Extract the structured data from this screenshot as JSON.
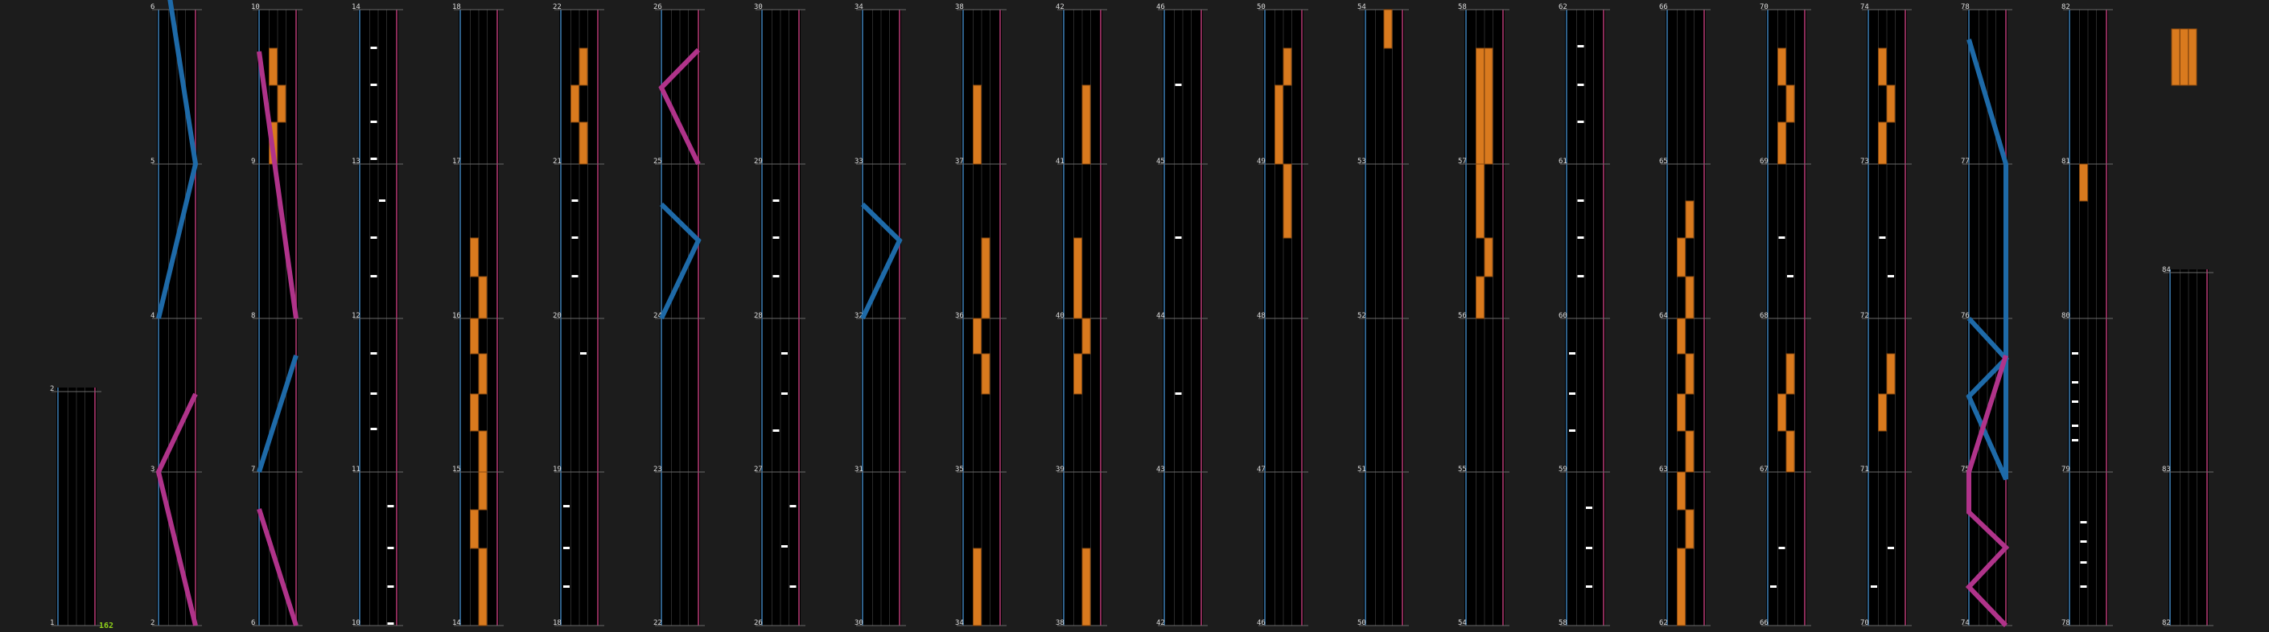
{
  "theme": {
    "background": "#1c1c1c",
    "lane_bg": "#000000",
    "grid": "#2a2a2a",
    "measure_line": "#6a6a6a",
    "left_border": "#2e5f88",
    "right_border": "#8a2c58",
    "note_color": "#ffffff",
    "hold_color": "#d97a1e",
    "hold_border": "#8a4a10",
    "laser_left": "#1e6aa8",
    "laser_right": "#b0338a",
    "combo_color": "#8fd11a",
    "label_color": "#dddddd"
  },
  "combo": "162",
  "columns": [
    {
      "labels": [
        "1",
        "2"
      ],
      "partial": true
    },
    {
      "labels": [
        "2",
        "3",
        "4",
        "5",
        "6"
      ]
    },
    {
      "labels": [
        "6",
        "7",
        "8",
        "9",
        "10"
      ]
    },
    {
      "labels": [
        "10",
        "11",
        "12",
        "13",
        "14"
      ]
    },
    {
      "labels": [
        "14",
        "15",
        "16",
        "17",
        "18"
      ]
    },
    {
      "labels": [
        "18",
        "19",
        "20",
        "21",
        "22"
      ]
    },
    {
      "labels": [
        "22",
        "23",
        "24",
        "25",
        "26"
      ]
    },
    {
      "labels": [
        "26",
        "27",
        "28",
        "29",
        "30"
      ]
    },
    {
      "labels": [
        "30",
        "31",
        "32",
        "33",
        "34"
      ]
    },
    {
      "labels": [
        "34",
        "35",
        "36",
        "37",
        "38"
      ]
    },
    {
      "labels": [
        "38",
        "39",
        "40",
        "41",
        "42"
      ]
    },
    {
      "labels": [
        "42",
        "43",
        "44",
        "45",
        "46"
      ]
    },
    {
      "labels": [
        "46",
        "47",
        "48",
        "49",
        "50"
      ]
    },
    {
      "labels": [
        "50",
        "51",
        "52",
        "53",
        "54"
      ]
    },
    {
      "labels": [
        "54",
        "55",
        "56",
        "57",
        "58"
      ]
    },
    {
      "labels": [
        "58",
        "59",
        "60",
        "61",
        "62"
      ]
    },
    {
      "labels": [
        "62",
        "63",
        "64",
        "65",
        "66"
      ]
    },
    {
      "labels": [
        "66",
        "67",
        "68",
        "69",
        "70"
      ]
    },
    {
      "labels": [
        "70",
        "71",
        "72",
        "73",
        "74"
      ]
    },
    {
      "labels": [
        "74",
        "75",
        "76",
        "77",
        "78"
      ]
    },
    {
      "labels": [
        "78",
        "79",
        "80",
        "81",
        "82"
      ]
    },
    {
      "labels": [
        "82",
        "83",
        "84"
      ],
      "partial": true
    }
  ]
}
